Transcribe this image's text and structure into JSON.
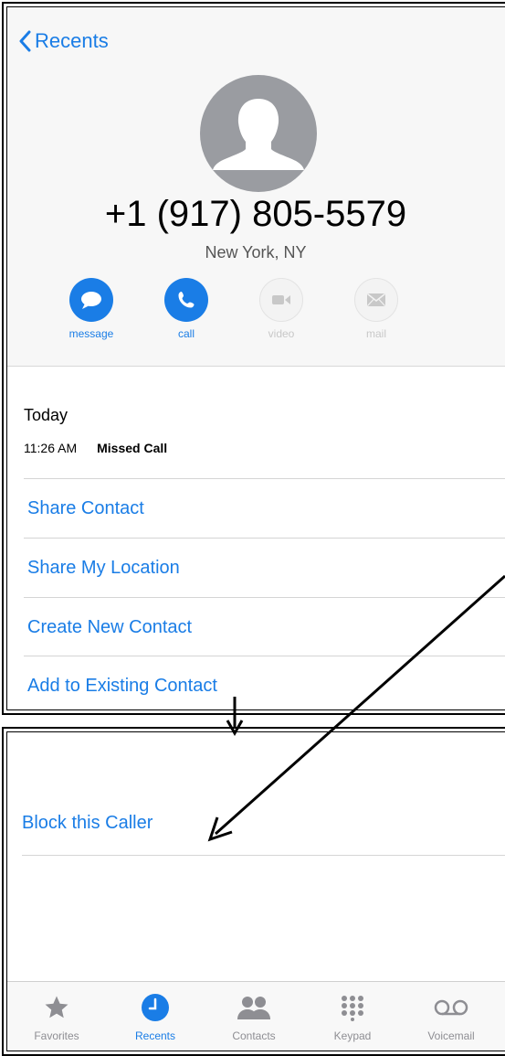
{
  "header": {
    "back_label": "Recents"
  },
  "contact": {
    "phone_number": "+1 (917) 805-5579",
    "location": "New York, NY"
  },
  "actions": [
    {
      "label": "message",
      "icon": "message-bubble-icon",
      "enabled": true
    },
    {
      "label": "call",
      "icon": "phone-icon",
      "enabled": true
    },
    {
      "label": "video",
      "icon": "video-camera-icon",
      "enabled": false
    },
    {
      "label": "mail",
      "icon": "envelope-icon",
      "enabled": false
    }
  ],
  "call_log": {
    "day": "Today",
    "time": "11:26 AM",
    "type": "Missed Call"
  },
  "options": [
    "Share Contact",
    "Share My Location",
    "Create New Contact",
    "Add to Existing Contact"
  ],
  "block": {
    "label": "Block this Caller"
  },
  "tabbar": {
    "selected": "Recents",
    "items": [
      {
        "label": "Favorites",
        "icon": "star-icon"
      },
      {
        "label": "Recents",
        "icon": "clock-icon"
      },
      {
        "label": "Contacts",
        "icon": "contacts-icon"
      },
      {
        "label": "Keypad",
        "icon": "keypad-icon"
      },
      {
        "label": "Voicemail",
        "icon": "voicemail-icon"
      }
    ]
  },
  "colors": {
    "accent": "#1a7de6",
    "header_bg": "#f7f7f7",
    "inactive": "#c8c8c8"
  }
}
